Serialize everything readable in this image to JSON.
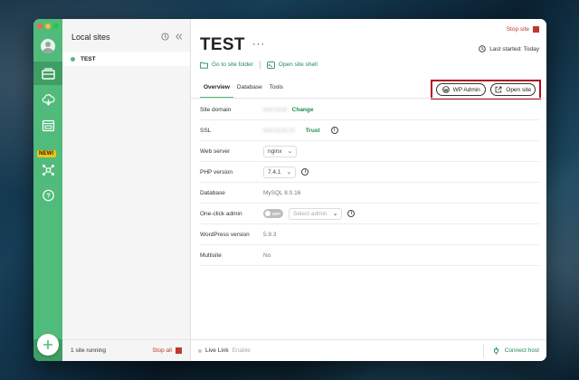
{
  "window": {
    "traffic_lights": [
      "#ff5f57",
      "#febc2e",
      "#28c840"
    ]
  },
  "rail": {
    "new_badge": "NEW!"
  },
  "sites_panel": {
    "title": "Local sites",
    "sites": [
      {
        "name": "TEST",
        "status_color": "#51bb7b"
      }
    ],
    "footer": {
      "running_count": "1",
      "running_text": "site running",
      "stop_all": "Stop all"
    }
  },
  "site": {
    "title": "TEST",
    "more": "···",
    "stop_site": "Stop site",
    "last_started": "Last started: Today",
    "go_to_folder": "Go to site folder",
    "open_shell": "Open site shell",
    "tabs": [
      "Overview",
      "Database",
      "Tools"
    ],
    "wp_admin": "WP Admin",
    "open_site": "Open site",
    "overview": {
      "site_domain": {
        "label": "Site domain",
        "value": "test.local",
        "action": "Change"
      },
      "ssl": {
        "label": "SSL",
        "value": "test.local.crt",
        "action": "Trust"
      },
      "web_server": {
        "label": "Web server",
        "value": "nginx"
      },
      "php_version": {
        "label": "PHP version",
        "value": "7.4.1"
      },
      "database": {
        "label": "Database",
        "value": "MySQL 8.0.16"
      },
      "one_click_admin": {
        "label": "One-click admin",
        "toggle": "OFF",
        "placeholder": "Select admin"
      },
      "wp_version": {
        "label": "WordPress version",
        "value": "5.9.3"
      },
      "multisite": {
        "label": "Multisite",
        "value": "No"
      }
    },
    "footer": {
      "live_link": "Live Link",
      "enable": "Enable",
      "connect_host": "Connect host"
    }
  },
  "colors": {
    "accent": "#51bb7b",
    "link": "#1d8b52",
    "danger": "#c0392b",
    "highlight_box": "#b00e1a"
  }
}
